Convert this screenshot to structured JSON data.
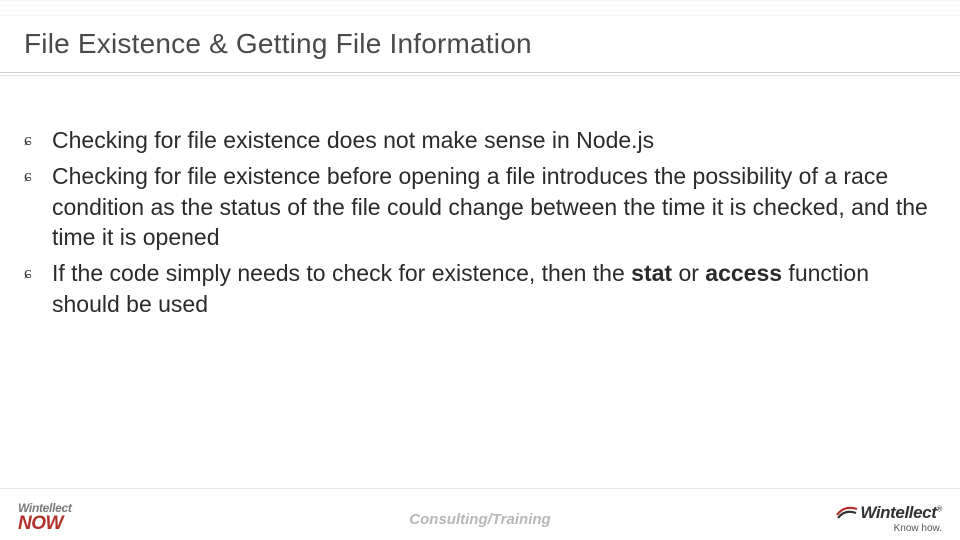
{
  "title": "File Existence & Getting File Information",
  "bullets": [
    {
      "runs": [
        {
          "t": "Checking for file existence does not make sense in Node.js"
        }
      ]
    },
    {
      "runs": [
        {
          "t": "Checking for file existence before opening a file introduces the possibility of a race condition as the status of the file could change between the time it is checked, and the time it is opened"
        }
      ]
    },
    {
      "runs": [
        {
          "t": "If the code simply needs to check for existence, then the "
        },
        {
          "t": "stat",
          "bold": true
        },
        {
          "t": " or "
        },
        {
          "t": "access",
          "bold": true
        },
        {
          "t": " function should be used"
        }
      ]
    }
  ],
  "footer": {
    "left_top": "Wintellect",
    "left_bottom": "NOW",
    "center": "Consulting/Training",
    "right_brand": "Wintellect",
    "right_reg": "®",
    "right_tag": "Know how."
  }
}
